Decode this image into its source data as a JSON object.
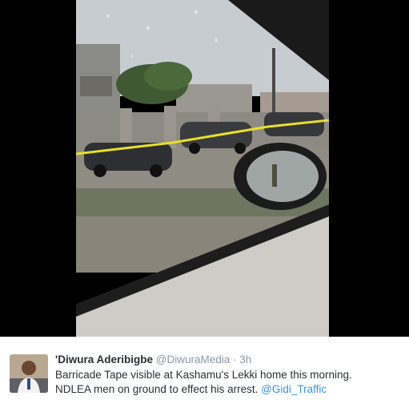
{
  "tweet": {
    "display_name": "'Diwura Aderibigbe",
    "handle": "@DiwuraMedia",
    "separator": "·",
    "time": "3h",
    "text_line1": "Barricade Tape visible at Kashamu's Lekki home this morning.",
    "text_line2": "NDLEA men on ground to effect his arrest.",
    "mention": "@Gidi_Traffic"
  },
  "colors": {
    "name": "#292f33",
    "meta": "#8899a6",
    "link": "#3b94d9",
    "photo_frame": "#000000",
    "barricade_tape": "#e8e02a"
  },
  "icons": {
    "avatar": "user-avatar-photo"
  }
}
